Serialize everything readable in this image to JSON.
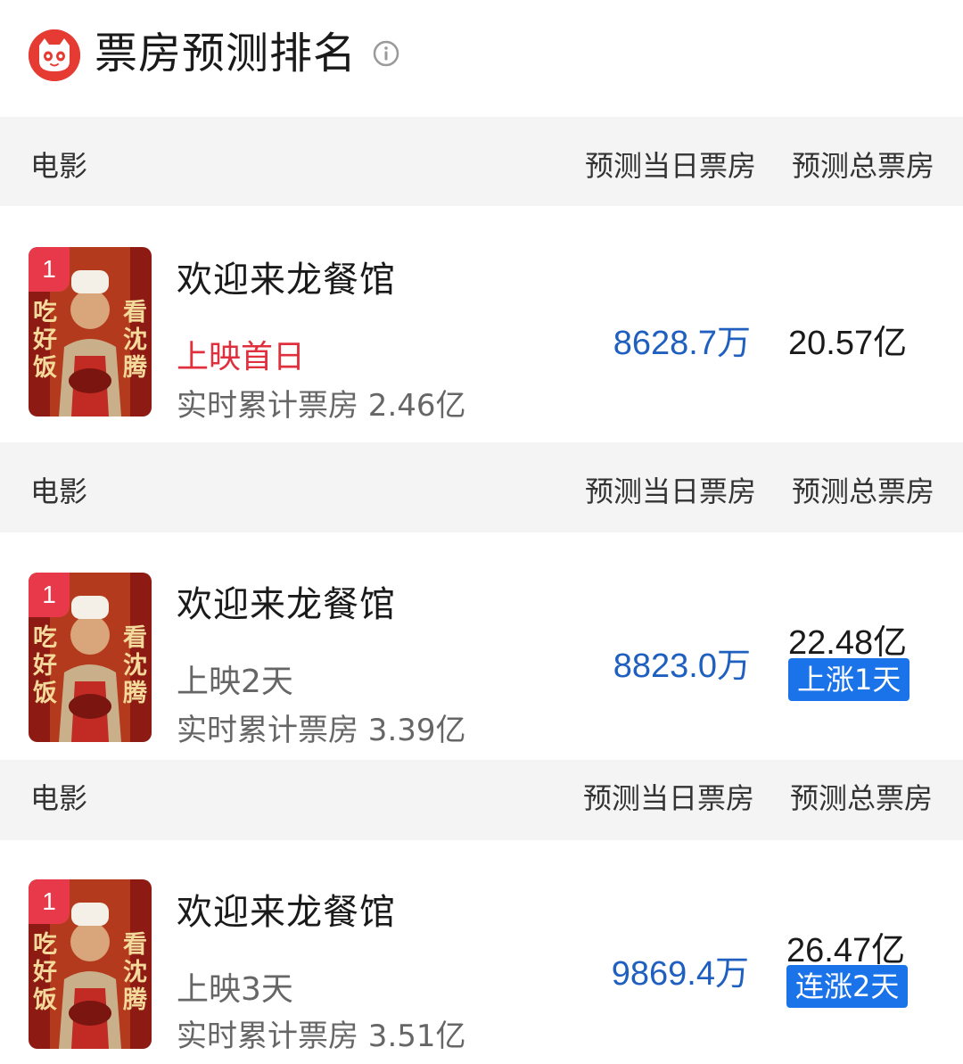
{
  "header": {
    "title": "票房预测排名",
    "logo_icon": "maoyan-cat-icon",
    "info_icon": "info-circle-icon"
  },
  "columns": {
    "movie": "电影",
    "daily_forecast": "预测当日票房",
    "total_forecast": "预测总票房"
  },
  "rows": [
    {
      "rank": "1",
      "name": "欢迎来龙餐馆",
      "release": "上映首日",
      "cumulative_label": "实时累计票房 2.46亿",
      "daily": "8628.7万",
      "total": "20.57亿",
      "trend": ""
    },
    {
      "rank": "1",
      "name": "欢迎来龙餐馆",
      "release": "上映2天",
      "cumulative_label": "实时累计票房 3.39亿",
      "daily": "8823.0万",
      "total": "22.48亿",
      "trend": "上涨1天"
    },
    {
      "rank": "1",
      "name": "欢迎来龙餐馆",
      "release": "上映3天",
      "cumulative_label": "实时累计票房 3.51亿",
      "daily": "9869.4万",
      "total": "26.47亿",
      "trend": "连涨2天"
    }
  ],
  "poster": {
    "left_text": "吃好饭",
    "right_text": "看沈腾"
  },
  "colors": {
    "accent_blue": "#1f5fbf",
    "badge_blue": "#1a73e8",
    "first_day_red": "#e0303d",
    "rank_red": "#e8394a",
    "header_bg": "#f4f4f4"
  }
}
